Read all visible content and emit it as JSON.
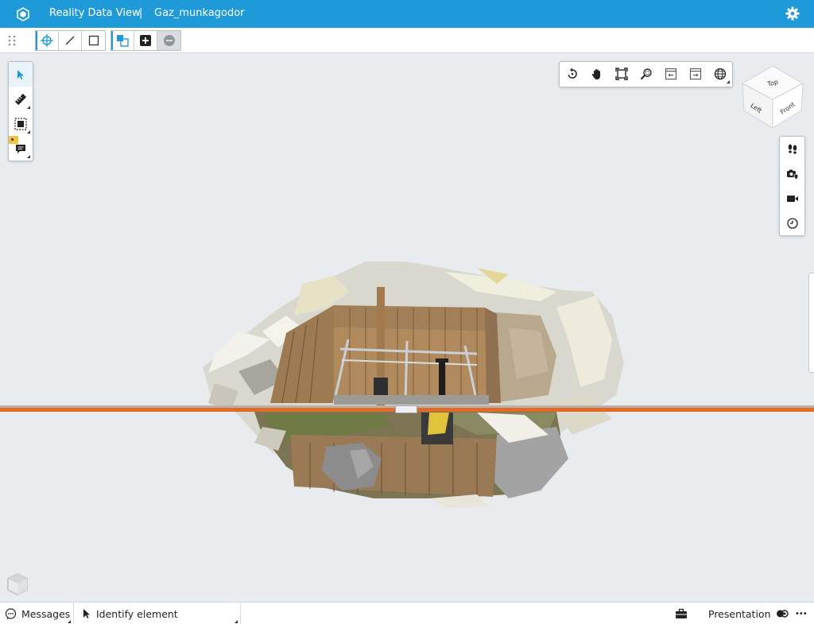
{
  "titlebar": {
    "app_title": "Reality Data View",
    "separator": "|",
    "project_name": "Gaz_munkagodor",
    "icons": {
      "logo": "app-logo-icon",
      "settings": "gear-icon"
    }
  },
  "toolbar": {
    "group1": [
      "point-snap-icon",
      "line-icon",
      "rectangle-icon"
    ],
    "group2": [
      "select-add-icon",
      "plus-icon",
      "minus-icon"
    ]
  },
  "left_tools": [
    "select-arrow-icon",
    "measure-ruler-icon",
    "fit-to-view-icon",
    "comment-icon"
  ],
  "view_tools": [
    "rotate-icon",
    "pan-hand-icon",
    "fit-view-icon",
    "zoom-window-icon",
    "previous-view-icon",
    "next-view-icon",
    "globe-icon"
  ],
  "view_cube": {
    "top": "Top",
    "left": "Left",
    "front": "Front"
  },
  "right_tools": [
    "walk-footprints-icon",
    "camera-location-icon",
    "video-camera-icon",
    "history-clock-icon"
  ],
  "colors": {
    "accent": "#1e9ad8",
    "clip_line": "#e06a26",
    "background": "#e8ecef"
  },
  "statusbar": {
    "messages_label": "Messages",
    "identify_label": "Identify element",
    "presentation_label": "Presentation",
    "more_label": "•••"
  }
}
